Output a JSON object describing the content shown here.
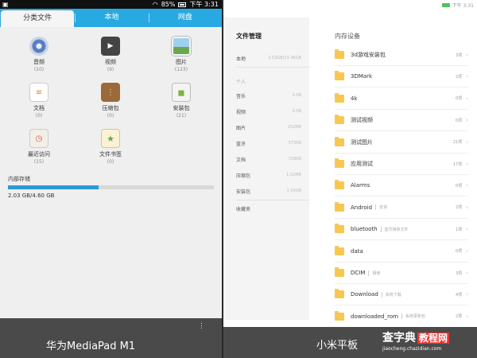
{
  "left": {
    "status": {
      "battery": "85%",
      "time": "下午 3:31"
    },
    "tabs": [
      {
        "label": "分类文件"
      },
      {
        "label": "本地"
      },
      {
        "label": "网盘"
      }
    ],
    "categories": [
      {
        "name": "音频",
        "count": "(10)",
        "icon": "music-disc-icon"
      },
      {
        "name": "视频",
        "count": "(9)",
        "icon": "video-clapper-icon"
      },
      {
        "name": "图片",
        "count": "(123)",
        "icon": "image-icon"
      },
      {
        "name": "文档",
        "count": "(0)",
        "icon": "document-icon"
      },
      {
        "name": "压缩包",
        "count": "(0)",
        "icon": "zip-icon"
      },
      {
        "name": "安装包",
        "count": "(21)",
        "icon": "apk-icon"
      },
      {
        "name": "最近访问",
        "count": "(15)",
        "icon": "recent-clock-icon"
      },
      {
        "name": "文件书签",
        "count": "(0)",
        "icon": "bookmark-star-icon"
      }
    ],
    "storage": {
      "label": "内部存储",
      "value": "2.03 GB/4.60 GB",
      "fraction": 0.44
    },
    "caption": "华为MediaPad M1"
  },
  "right": {
    "status": {
      "time": "下午 3:31"
    },
    "sidebar": {
      "title": "文件管理",
      "rows": [
        {
          "label": "本地",
          "size": "2.53GB/13.46GB"
        },
        {
          "label": "个人",
          "size": "",
          "header": true
        },
        {
          "label": "音乐",
          "size": "0.0B"
        },
        {
          "label": "视频",
          "size": "0.0B"
        },
        {
          "label": "图片",
          "size": "232MB"
        },
        {
          "label": "蓝牙",
          "size": "573KB"
        },
        {
          "label": "文档",
          "size": "728KB"
        },
        {
          "label": "压缩包",
          "size": "1.02MB"
        },
        {
          "label": "安装包",
          "size": "1.50GB"
        },
        {
          "label": "收藏夹",
          "size": ""
        }
      ]
    },
    "main": {
      "title": "内存设备",
      "files": [
        {
          "name": "3d游戏安装包",
          "note": "",
          "count": "3项"
        },
        {
          "name": "3DMark",
          "note": "",
          "count": "2项"
        },
        {
          "name": "4k",
          "note": "",
          "count": "0项"
        },
        {
          "name": "测试视频",
          "note": "",
          "count": "0项"
        },
        {
          "name": "测试图片",
          "note": "",
          "count": "21项"
        },
        {
          "name": "应用测试",
          "note": "",
          "count": "17项"
        },
        {
          "name": "Alarms",
          "note": "",
          "count": "0项"
        },
        {
          "name": "Android",
          "note": "安卓",
          "count": "2项"
        },
        {
          "name": "bluetooth",
          "note": "蓝牙接收文件",
          "count": "1项"
        },
        {
          "name": "data",
          "note": "",
          "count": "0项"
        },
        {
          "name": "DCIM",
          "note": "相册",
          "count": "3项"
        },
        {
          "name": "Download",
          "note": "系统下载",
          "count": "4项"
        },
        {
          "name": "downloaded_rom",
          "note": "系统更新包",
          "count": "2项"
        }
      ]
    },
    "caption": "小米平板",
    "watermark": {
      "line1": "查字典",
      "accent": "教程网",
      "line2": "jiaocheng.chazidian.com"
    }
  }
}
